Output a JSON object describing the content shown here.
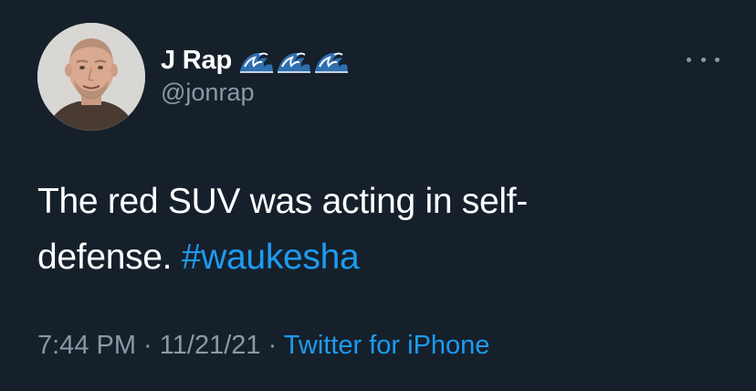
{
  "user": {
    "display_name": "J Rap",
    "name_emoji": [
      "water-wave-icon",
      "water-wave-icon",
      "water-wave-icon"
    ],
    "handle": "@jonrap"
  },
  "tweet": {
    "text_line1": "The red SUV was acting in self-",
    "text_line2": "defense.",
    "hashtag": "#waukesha"
  },
  "meta": {
    "time": "7:44 PM",
    "separator1": " · ",
    "date": "11/21/21",
    "separator2": " · ",
    "source": "Twitter for iPhone"
  },
  "colors": {
    "background": "#15202b",
    "text": "#ffffff",
    "secondary": "#8b98a5",
    "link": "#1d9bf0"
  }
}
